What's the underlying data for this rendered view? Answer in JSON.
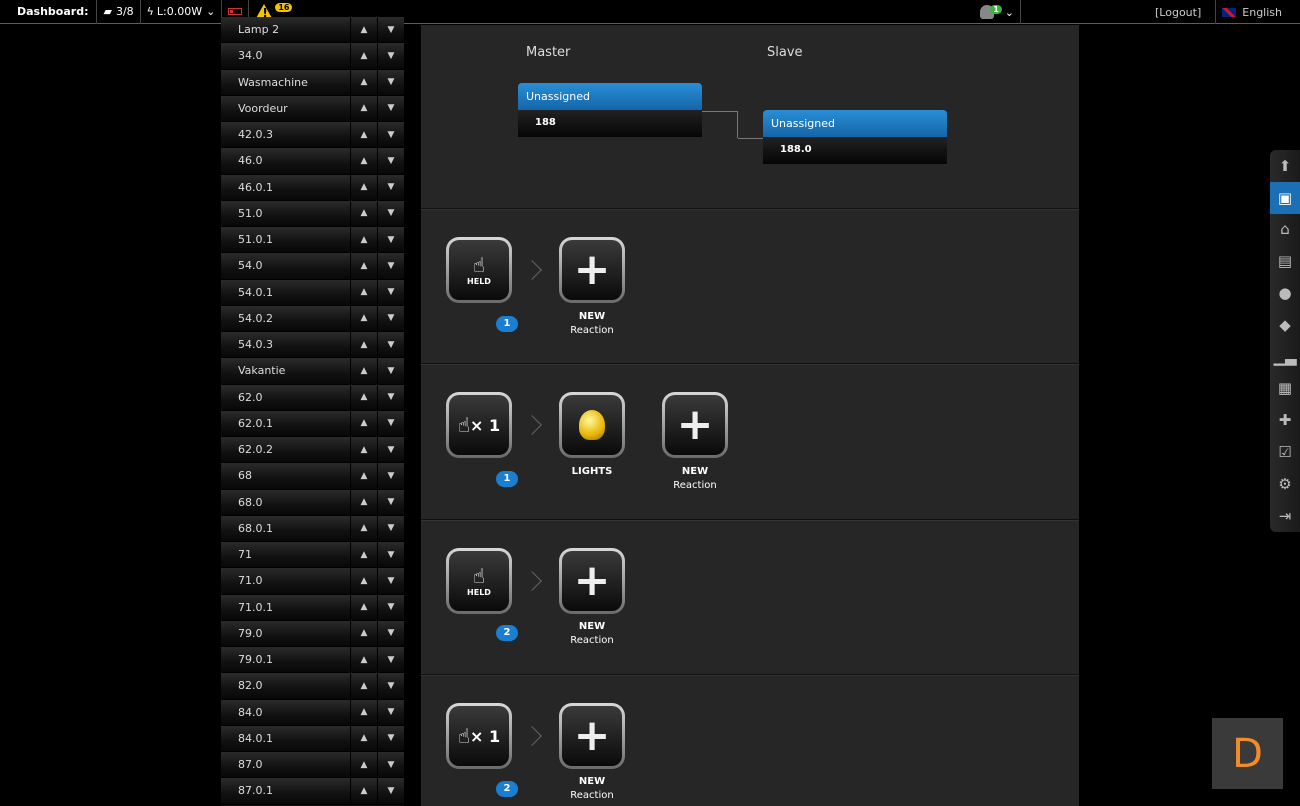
{
  "topbar": {
    "dashboard_label": "Dashboard:",
    "devices": "3/8",
    "power": "L:0.00W",
    "warning_count": "16",
    "user_badge": "1",
    "logout": "[Logout]",
    "language": "English"
  },
  "sidebar": {
    "items": [
      "Lamp 2",
      "34.0",
      "Wasmachine",
      "Voordeur",
      "42.0.3",
      "46.0",
      "46.0.1",
      "51.0",
      "51.0.1",
      "54.0",
      "54.0.1",
      "54.0.2",
      "54.0.3",
      "Vakantie",
      "62.0",
      "62.0.1",
      "62.0.2",
      "68",
      "68.0",
      "68.0.1",
      "71",
      "71.0",
      "71.0.1",
      "79.0",
      "79.0.1",
      "82.0",
      "84.0",
      "84.0.1",
      "87.0",
      "87.0.1"
    ]
  },
  "master_slave": {
    "master_title": "Master",
    "slave_title": "Slave",
    "master_header": "Unassigned",
    "master_value": "188",
    "slave_header": "Unassigned",
    "slave_value": "188.0"
  },
  "events": [
    {
      "trigger": "HELD",
      "badge": "1",
      "reactions": [
        {
          "name": "NEW",
          "sub": "Reaction"
        }
      ]
    },
    {
      "trigger": "× 1",
      "badge": "1",
      "reactions": [
        {
          "name": "LIGHTS",
          "sub": ""
        },
        {
          "name": "NEW",
          "sub": "Reaction"
        }
      ]
    },
    {
      "trigger": "HELD",
      "badge": "2",
      "reactions": [
        {
          "name": "NEW",
          "sub": "Reaction"
        }
      ]
    },
    {
      "trigger": "× 1",
      "badge": "2",
      "reactions": [
        {
          "name": "NEW",
          "sub": "Reaction"
        }
      ]
    }
  ],
  "toolbar_icons": [
    "upload-icon",
    "save-icon",
    "home-icon",
    "devices-icon",
    "location-icon",
    "tag-icon",
    "chart-icon",
    "gift-icon",
    "plugin-icon",
    "schedule-icon",
    "settings-icon",
    "exit-icon"
  ],
  "corner_logo": "D"
}
